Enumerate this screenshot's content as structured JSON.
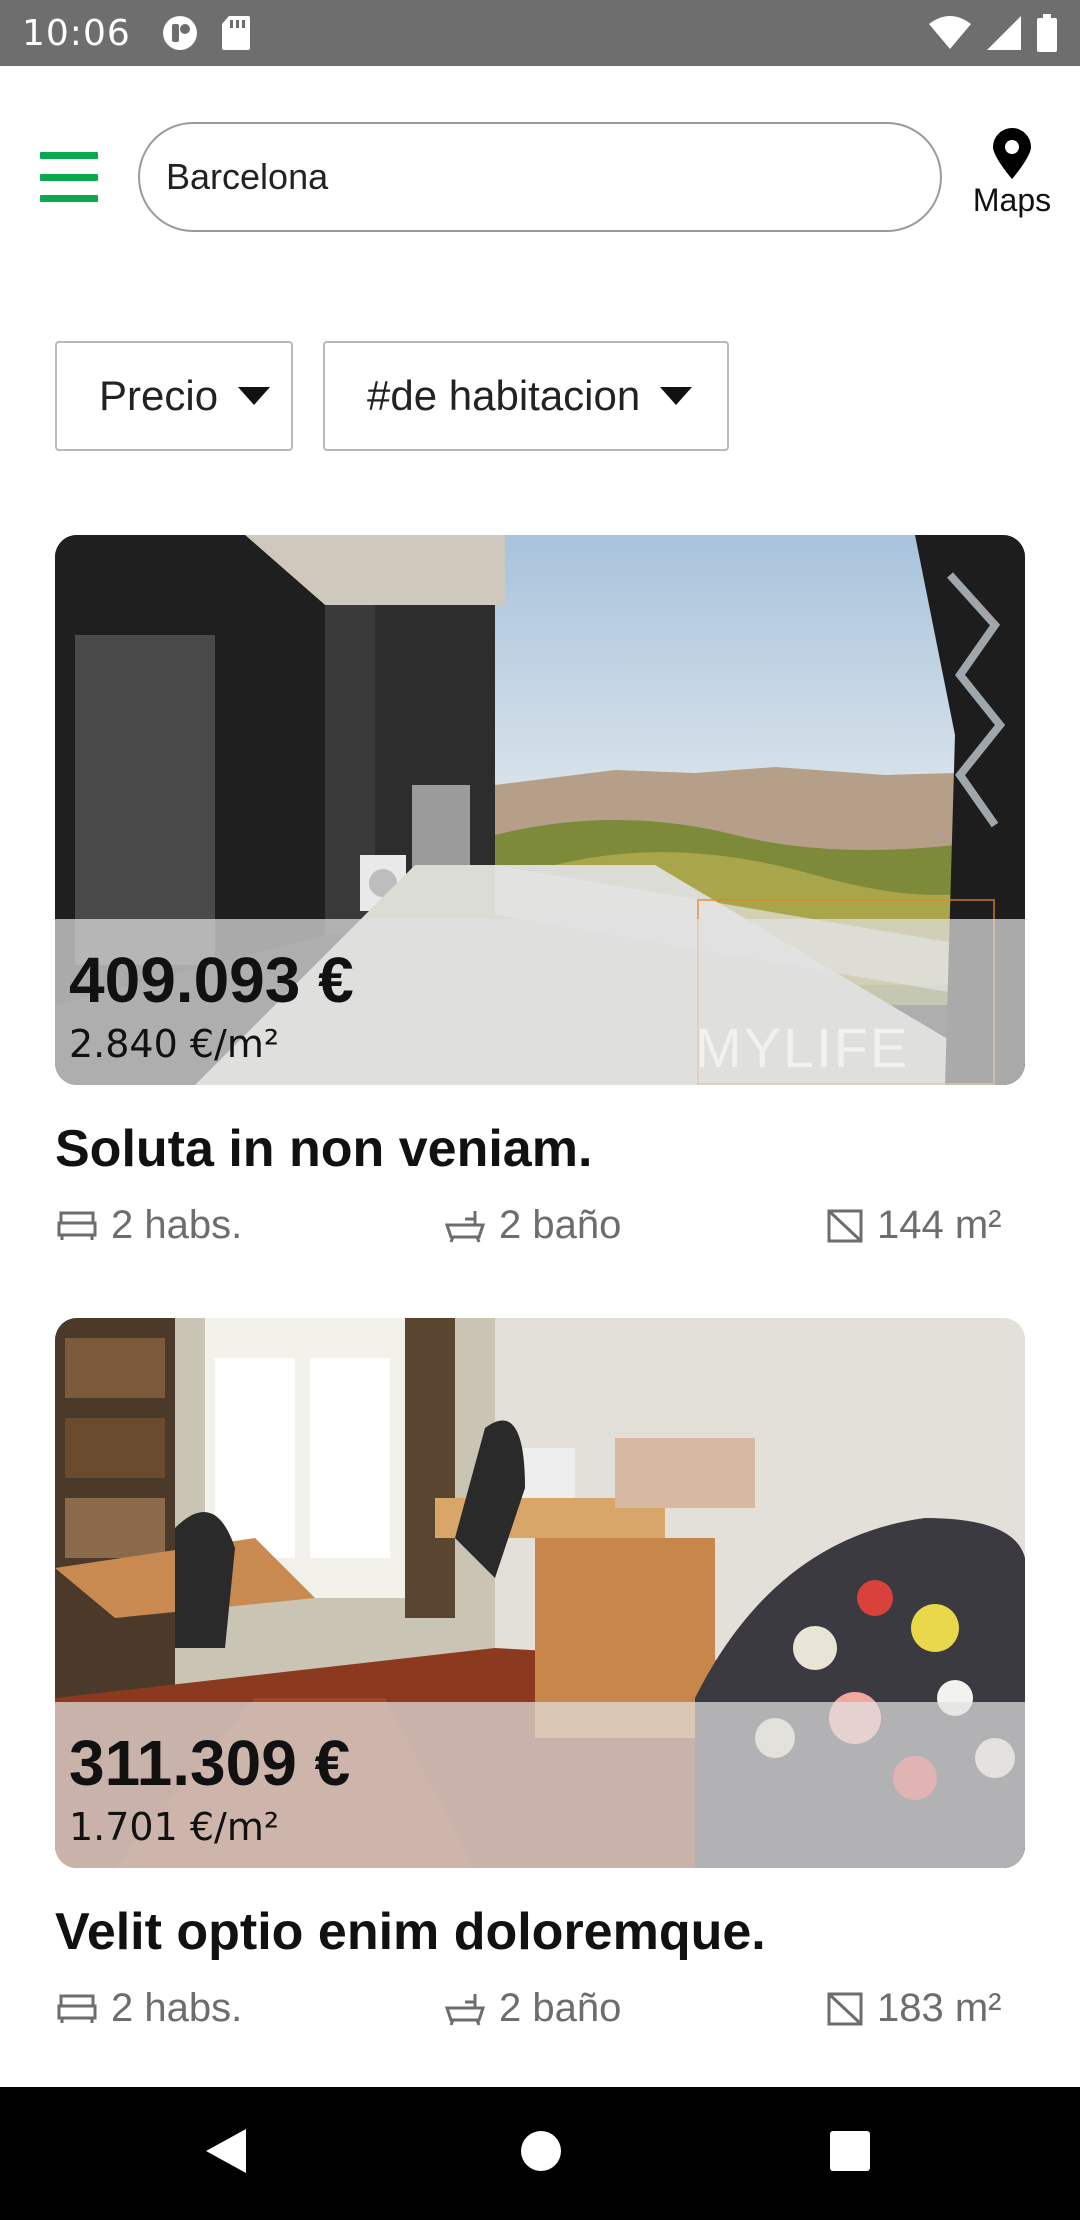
{
  "status_bar": {
    "time": "10:06"
  },
  "header": {
    "search_value": "Barcelona",
    "maps_label": "Maps"
  },
  "filters": {
    "price_label": "Precio",
    "rooms_label": "#de habitacion"
  },
  "listings": [
    {
      "price": "409.093 €",
      "price_m2": "2.840 €/m²",
      "watermark": "MYLIFE",
      "title": "Soluta in non veniam.",
      "rooms": "2 habs.",
      "baths": "2 baño",
      "area": "144 m²"
    },
    {
      "price": "311.309 €",
      "price_m2": "1.701 €/m²",
      "title": "Velit optio enim doloremque.",
      "rooms": "2 habs.",
      "baths": "2 baño",
      "area": "183 m²"
    }
  ],
  "colors": {
    "accent": "#0aa84f",
    "status_bar": "#6e6e6e",
    "nav_bar": "#000000",
    "feature_text": "#6d6d6d"
  },
  "icons": [
    "menu-icon",
    "map-pin-icon",
    "chevron-down-icon",
    "bed-icon",
    "bathtub-icon",
    "area-icon",
    "back-icon",
    "home-icon",
    "recents-icon"
  ]
}
